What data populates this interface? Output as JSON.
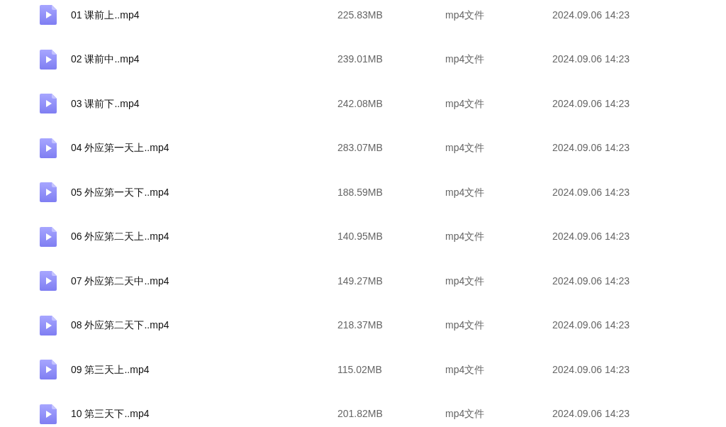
{
  "files": [
    {
      "name": "01 课前上..mp4",
      "size": "225.83MB",
      "type": "mp4文件",
      "modified": "2024.09.06 14:23"
    },
    {
      "name": "02 课前中..mp4",
      "size": "239.01MB",
      "type": "mp4文件",
      "modified": "2024.09.06 14:23"
    },
    {
      "name": "03 课前下..mp4",
      "size": "242.08MB",
      "type": "mp4文件",
      "modified": "2024.09.06 14:23"
    },
    {
      "name": "04 外应第一天上..mp4",
      "size": "283.07MB",
      "type": "mp4文件",
      "modified": "2024.09.06 14:23"
    },
    {
      "name": "05 外应第一天下..mp4",
      "size": "188.59MB",
      "type": "mp4文件",
      "modified": "2024.09.06 14:23"
    },
    {
      "name": "06 外应第二天上..mp4",
      "size": "140.95MB",
      "type": "mp4文件",
      "modified": "2024.09.06 14:23"
    },
    {
      "name": "07 外应第二天中..mp4",
      "size": "149.27MB",
      "type": "mp4文件",
      "modified": "2024.09.06 14:23"
    },
    {
      "name": "08 外应第二天下..mp4",
      "size": "218.37MB",
      "type": "mp4文件",
      "modified": "2024.09.06 14:23"
    },
    {
      "name": "09 第三天上..mp4",
      "size": "115.02MB",
      "type": "mp4文件",
      "modified": "2024.09.06 14:23"
    },
    {
      "name": "10 第三天下..mp4",
      "size": "201.82MB",
      "type": "mp4文件",
      "modified": "2024.09.06 14:23"
    }
  ]
}
